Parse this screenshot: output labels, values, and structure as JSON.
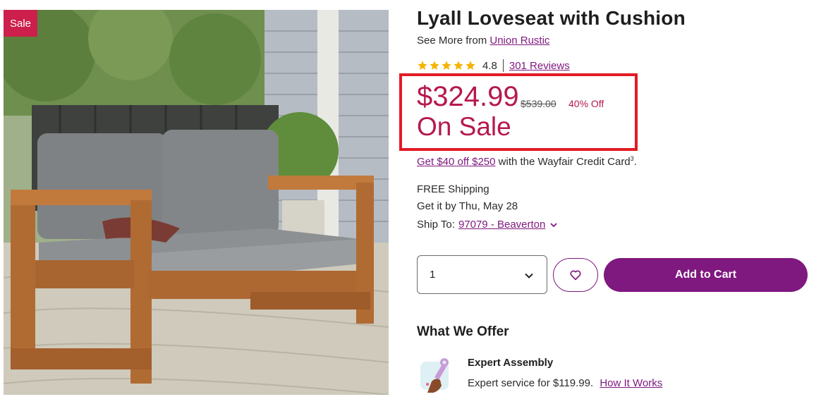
{
  "product": {
    "sale_badge": "Sale",
    "title": "Lyall Loveseat with Cushion",
    "see_more_prefix": "See More from",
    "brand": "Union Rustic",
    "rating": "4.8",
    "stars": 5,
    "reviews": "301 Reviews"
  },
  "pricing": {
    "price": "$324.99",
    "old_price": "$539.00",
    "discount": "40% Off",
    "sale_label": "On Sale",
    "credit_offer_link": "Get $40 off $250",
    "credit_offer_text": " with the Wayfair Credit Card",
    "credit_footnote": "3",
    "credit_end": "."
  },
  "shipping": {
    "free": "FREE Shipping",
    "eta": "Get it by Thu, May 28",
    "ship_to_label": "Ship To:",
    "ship_to_location": "97079 - Beaverton"
  },
  "controls": {
    "quantity": "1",
    "add_to_cart": "Add to Cart"
  },
  "offers": {
    "heading": "What We Offer",
    "assembly_title": "Expert Assembly",
    "assembly_text": "Expert service for $119.99.",
    "assembly_link": "How It Works"
  },
  "colors": {
    "accent_purple": "#7f187f",
    "sale_red": "#b5194e",
    "highlight_box": "#e21b24",
    "star_gold": "#f5b301"
  }
}
